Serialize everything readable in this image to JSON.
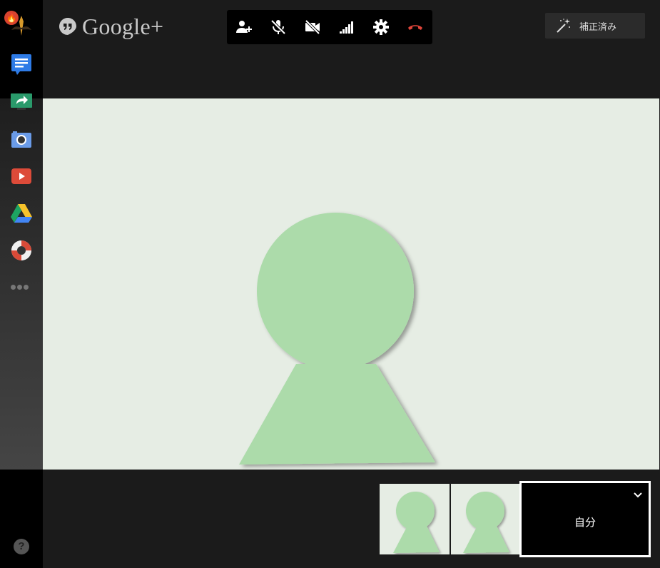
{
  "header": {
    "logo_text": "Google+",
    "enhance_label": "補正済み"
  },
  "toolbar": {
    "buttons": [
      {
        "name": "invite-people-button",
        "icon": "person-add-icon"
      },
      {
        "name": "mute-microphone-button",
        "icon": "mic-off-icon"
      },
      {
        "name": "turn-off-camera-button",
        "icon": "videocam-off-icon"
      },
      {
        "name": "bandwidth-button",
        "icon": "signal-bars-icon"
      },
      {
        "name": "settings-button",
        "icon": "gear-icon"
      },
      {
        "name": "hang-up-button",
        "icon": "phone-hangup-icon"
      }
    ]
  },
  "sidebar": {
    "badge_icon": "flame-icon",
    "apps": [
      {
        "name": "chat",
        "icon": "chat-bubble-icon"
      },
      {
        "name": "screenshare",
        "icon": "screenshare-icon"
      },
      {
        "name": "capture",
        "icon": "camera-icon"
      },
      {
        "name": "youtube",
        "icon": "youtube-play-icon"
      },
      {
        "name": "drive",
        "icon": "drive-icon"
      },
      {
        "name": "hangout-toolbox",
        "icon": "lifebuoy-icon"
      }
    ],
    "more_icon": "more-dots-icon",
    "help_text": "?"
  },
  "filmstrip": {
    "participants": 2,
    "self_label": "自分"
  },
  "colors": {
    "avatar_fill": "#acdbaa",
    "video_bg": "#e6ede4",
    "hangup_red": "#e0453a"
  }
}
